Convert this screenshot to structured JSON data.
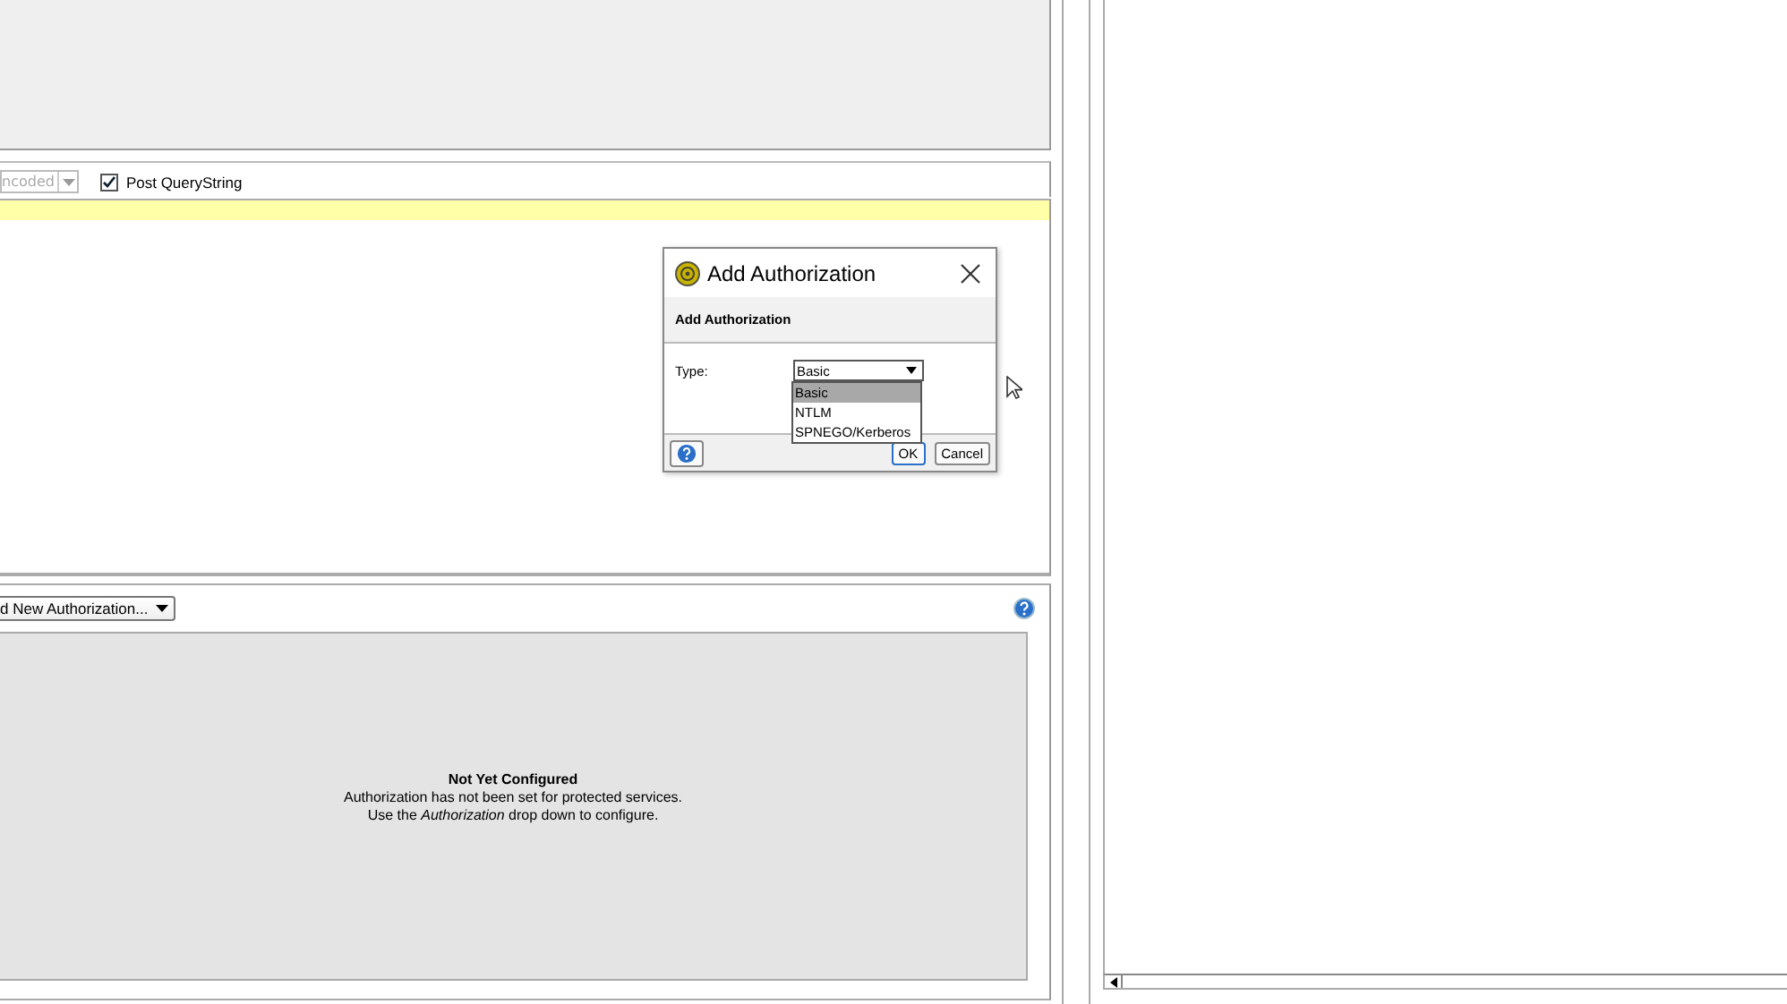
{
  "request_panel": {
    "encoding_combo": "ncoded",
    "post_querystring": {
      "label": "Post QueryString",
      "checked": true
    }
  },
  "auth_panel": {
    "add_dropdown": "d New Authorization...",
    "empty_title": "Not Yet Configured",
    "empty_lines": [
      "Authorization has not been set for protected services.",
      "Use the *Authorization* drop down to configure."
    ]
  },
  "dialog": {
    "title": "Add Authorization",
    "header": "Add Authorization",
    "type_label": "Type:",
    "type_value": "Basic",
    "options": [
      {
        "label": "Basic",
        "selected": true
      },
      {
        "label": "NTLM",
        "selected": false
      },
      {
        "label": "SPNEGO/Kerberos",
        "selected": false
      }
    ],
    "buttons": [
      {
        "label": "OK",
        "kind": "default"
      },
      {
        "label": "Cancel",
        "kind": "normal"
      }
    ]
  }
}
